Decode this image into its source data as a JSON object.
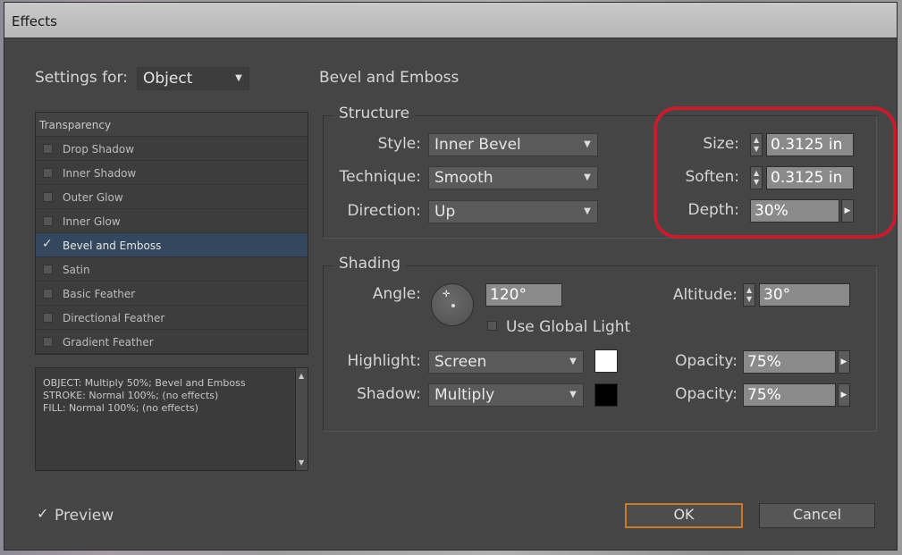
{
  "window": {
    "title": "Effects"
  },
  "settings_for": {
    "label": "Settings for:",
    "value": "Object"
  },
  "effects_list": {
    "header": "Transparency",
    "items": [
      {
        "label": "Drop Shadow",
        "checked": false
      },
      {
        "label": "Inner Shadow",
        "checked": false
      },
      {
        "label": "Outer Glow",
        "checked": false
      },
      {
        "label": "Inner Glow",
        "checked": false
      },
      {
        "label": "Bevel and Emboss",
        "checked": true,
        "selected": true
      },
      {
        "label": "Satin",
        "checked": false
      },
      {
        "label": "Basic Feather",
        "checked": false
      },
      {
        "label": "Directional Feather",
        "checked": false
      },
      {
        "label": "Gradient Feather",
        "checked": false
      }
    ]
  },
  "summary": {
    "lines": [
      "OBJECT: Multiply 50%; Bevel and Emboss",
      "STROKE: Normal 100%; (no effects)",
      "FILL: Normal 100%; (no effects)"
    ]
  },
  "panel_title": "Bevel and Emboss",
  "structure": {
    "title": "Structure",
    "style_label": "Style:",
    "style_value": "Inner Bevel",
    "technique_label": "Technique:",
    "technique_value": "Smooth",
    "direction_label": "Direction:",
    "direction_value": "Up",
    "size_label": "Size:",
    "size_value": "0.3125 in",
    "soften_label": "Soften:",
    "soften_value": "0.3125 in",
    "depth_label": "Depth:",
    "depth_value": "30%"
  },
  "shading": {
    "title": "Shading",
    "angle_label": "Angle:",
    "angle_value": "120°",
    "altitude_label": "Altitude:",
    "altitude_value": "30°",
    "global_light_label": "Use Global Light",
    "highlight_label": "Highlight:",
    "highlight_value": "Screen",
    "highlight_color": "#ffffff",
    "highlight_opacity_label": "Opacity:",
    "highlight_opacity_value": "75%",
    "shadow_label": "Shadow:",
    "shadow_value": "Multiply",
    "shadow_color": "#000000",
    "shadow_opacity_label": "Opacity:",
    "shadow_opacity_value": "75%"
  },
  "preview": {
    "label": "Preview",
    "checked": true
  },
  "buttons": {
    "ok": "OK",
    "cancel": "Cancel"
  },
  "colors": {
    "accent_ok_border": "#c87a2e",
    "annotation_ring": "#c41e2e",
    "selection": "#33475e"
  }
}
